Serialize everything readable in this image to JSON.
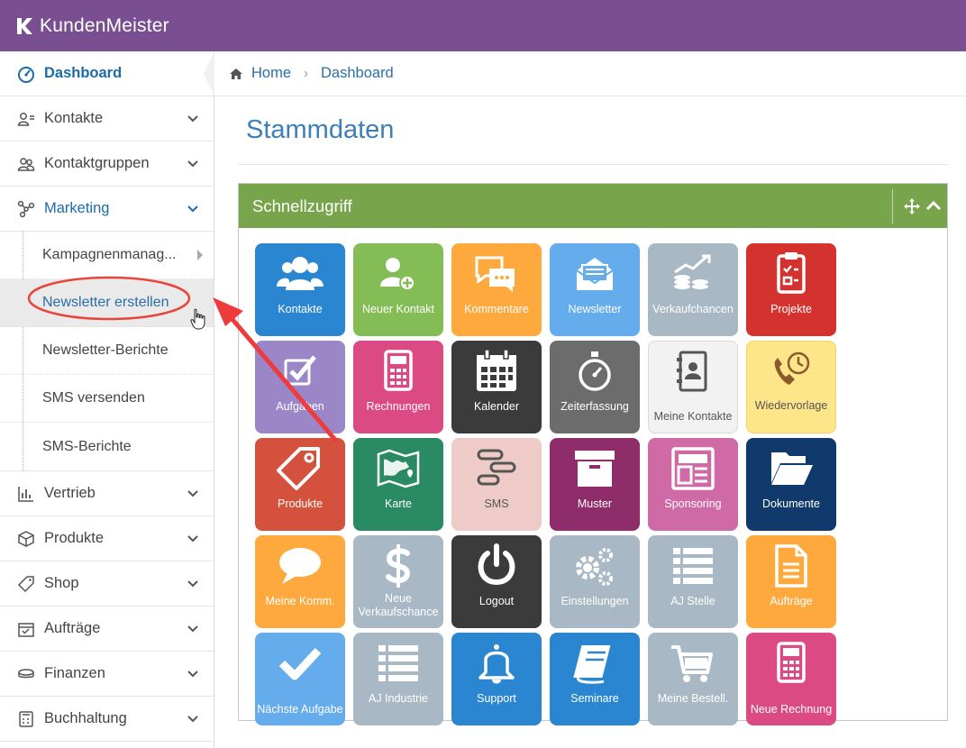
{
  "app": {
    "brand": "KundenMeister",
    "brand_color": "#7a4f91"
  },
  "sidebar": {
    "dashboard": "Dashboard",
    "items": [
      {
        "label": "Kontakte",
        "icon": "contacts-icon"
      },
      {
        "label": "Kontaktgruppen",
        "icon": "contact-groups-icon"
      },
      {
        "label": "Marketing",
        "icon": "marketing-icon"
      }
    ],
    "submenu": [
      {
        "label": "Kampagnenmanag..."
      },
      {
        "label": "Newsletter erstellen"
      },
      {
        "label": "Newsletter-Berichte"
      },
      {
        "label": "SMS versenden"
      },
      {
        "label": "SMS-Berichte"
      }
    ],
    "items_after": [
      {
        "label": "Vertrieb",
        "icon": "chart-icon"
      },
      {
        "label": "Produkte",
        "icon": "box-icon"
      },
      {
        "label": "Shop",
        "icon": "tag-icon"
      },
      {
        "label": "Aufträge",
        "icon": "orders-icon"
      },
      {
        "label": "Finanzen",
        "icon": "finance-icon"
      },
      {
        "label": "Buchhaltung",
        "icon": "calculator-icon"
      }
    ]
  },
  "breadcrumb": {
    "home": "Home",
    "current": "Dashboard"
  },
  "main": {
    "title": "Stammdaten"
  },
  "widget": {
    "title": "Schnellzugriff",
    "header_color": "#78a54c"
  },
  "tiles": [
    {
      "label": "Kontakte",
      "color": "#2a86d0",
      "icon": "users-icon"
    },
    {
      "label": "Neuer Kontakt",
      "color": "#84bd55",
      "icon": "add-user-icon"
    },
    {
      "label": "Kommentare",
      "color": "#fda93d",
      "icon": "comments-icon"
    },
    {
      "label": "Newsletter",
      "color": "#64acec",
      "icon": "envelope-open-icon"
    },
    {
      "label": "Verkaufchancen",
      "color": "#a8b8c4",
      "icon": "money-chart-icon"
    },
    {
      "label": "Projekte",
      "color": "#d3322f",
      "icon": "clipboard-icon"
    },
    {
      "label": "Aufgaben",
      "color": "#9b86c8",
      "icon": "checkbox-icon"
    },
    {
      "label": "Rechnungen",
      "color": "#dc4a83",
      "icon": "calculator-icon"
    },
    {
      "label": "Kalender",
      "color": "#3b3b3b",
      "icon": "calendar-icon"
    },
    {
      "label": "Zeiterfassung",
      "color": "#6c6c6c",
      "icon": "stopwatch-icon"
    },
    {
      "label": "Meine Kontakte",
      "color": "#f2f2f2",
      "icon": "address-book-icon",
      "light": true
    },
    {
      "label": "Wiedervorlage",
      "color": "#fde58a",
      "icon": "phone-clock-icon",
      "light": true
    },
    {
      "label": "Produkte",
      "color": "#d4523d",
      "icon": "tag-icon"
    },
    {
      "label": "Karte",
      "color": "#2a8a63",
      "icon": "map-icon"
    },
    {
      "label": "SMS",
      "color": "#efcbc8",
      "icon": "sms-icon",
      "light": true
    },
    {
      "label": "Muster",
      "color": "#8e2d6a",
      "icon": "archive-icon"
    },
    {
      "label": "Sponsoring",
      "color": "#d06aa6",
      "icon": "layout-icon"
    },
    {
      "label": "Dokumente",
      "color": "#0f3a6b",
      "icon": "folder-open-icon"
    },
    {
      "label": "Meine Komm.",
      "color": "#fda93d",
      "icon": "comment-icon"
    },
    {
      "label": "Neue Verkaufschance",
      "color": "#a8b8c4",
      "icon": "dollar-icon"
    },
    {
      "label": "Logout",
      "color": "#3b3b3b",
      "icon": "power-icon"
    },
    {
      "label": "Einstellungen",
      "color": "#a8b8c4",
      "icon": "gears-icon"
    },
    {
      "label": "AJ Stelle",
      "color": "#a8b8c4",
      "icon": "list-icon"
    },
    {
      "label": "Aufträge",
      "color": "#fda93d",
      "icon": "document-icon"
    },
    {
      "label": "Nächste Aufgabe",
      "color": "#64acec",
      "icon": "check-icon"
    },
    {
      "label": "AJ Industrie",
      "color": "#a8b8c4",
      "icon": "list-icon"
    },
    {
      "label": "Support",
      "color": "#2a86d0",
      "icon": "bell-icon"
    },
    {
      "label": "Seminare",
      "color": "#2a86d0",
      "icon": "book-icon"
    },
    {
      "label": "Meine Bestell.",
      "color": "#a8b8c4",
      "icon": "cart-icon"
    },
    {
      "label": "Neue Rechnung",
      "color": "#dc4a83",
      "icon": "calculator-icon"
    }
  ]
}
